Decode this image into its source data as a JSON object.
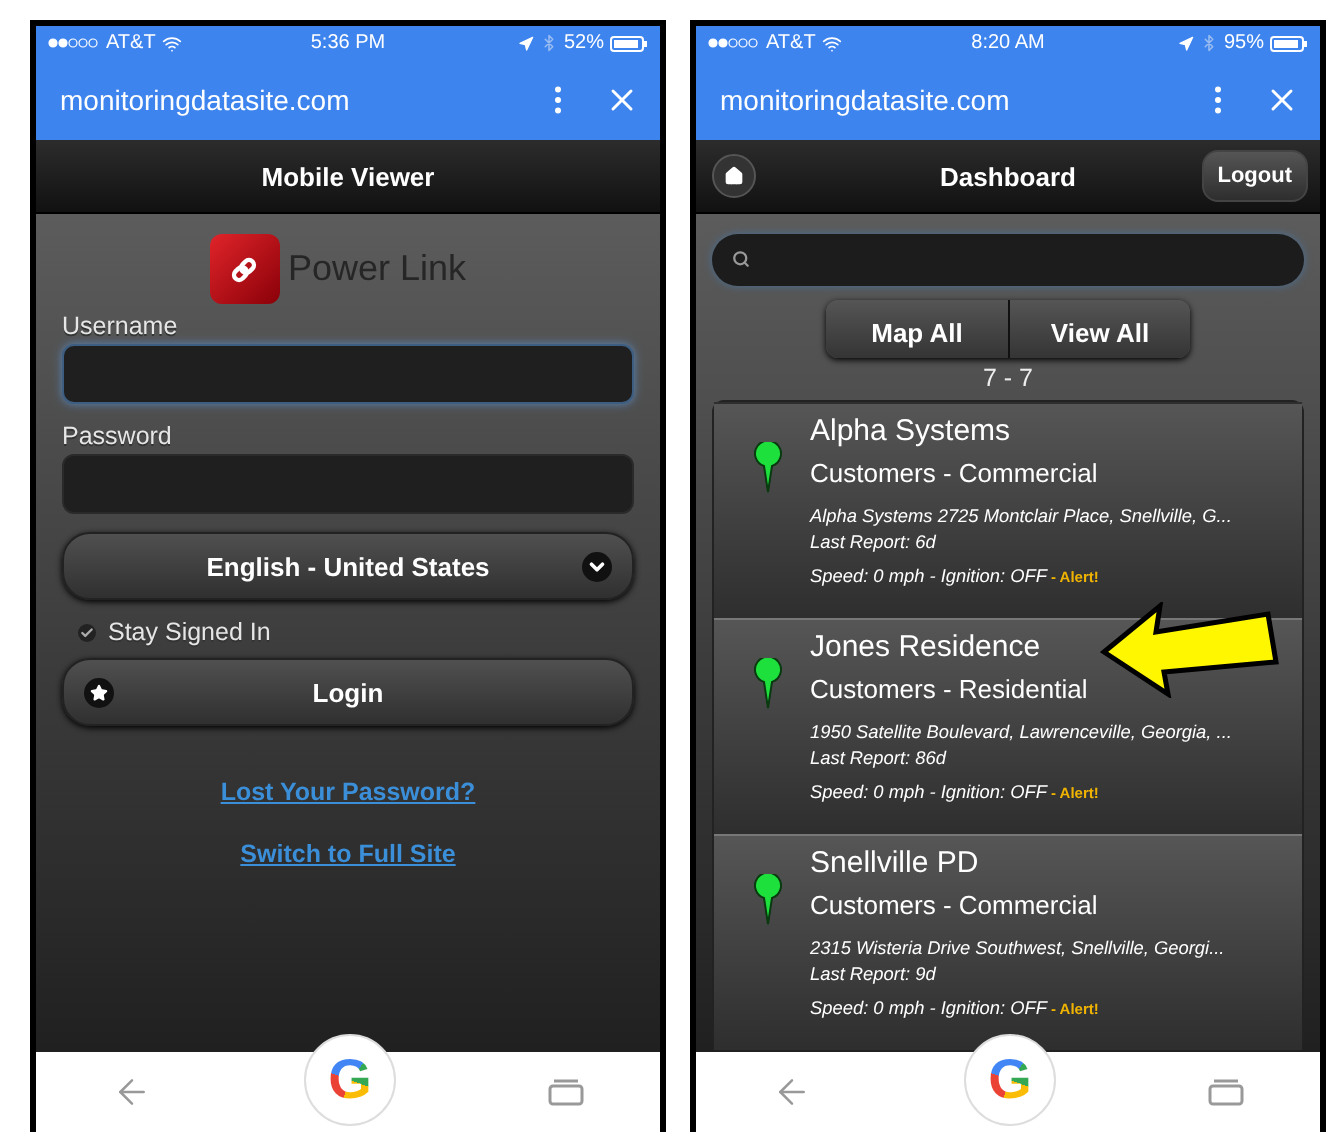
{
  "phones": [
    {
      "kind": "login",
      "status_bar": {
        "carrier": "AT&T",
        "time": "5:36 PM",
        "battery": "52%"
      },
      "browser": {
        "url": "monitoringdatasite.com"
      },
      "header": {
        "title": "Mobile Viewer"
      },
      "logo": {
        "name": "Power Link"
      },
      "fields": [
        {
          "label": "Username",
          "focused": true
        },
        {
          "label": "Password",
          "focused": false
        }
      ],
      "language": {
        "value": "English - United States"
      },
      "stay_signed_in": {
        "label": "Stay Signed In",
        "checked": true
      },
      "login_button": "Login",
      "links": [
        "Lost Your Password? ",
        "Switch to Full Site"
      ],
      "nav": {
        "logo_letter": "G"
      }
    },
    {
      "kind": "dashboard",
      "status_bar": {
        "carrier": "AT&T",
        "time": "8:20 AM",
        "battery": "95%"
      },
      "browser": {
        "url": "monitoringdatasite.com"
      },
      "header": {
        "title": "Dashboard",
        "logout": "Logout"
      },
      "buttons": [
        "Map All",
        "View All"
      ],
      "count": "7 - 7",
      "items": [
        {
          "name": "Alpha Systems",
          "category": "Customers - Commercial",
          "address": "Alpha Systems 2725 Montclair Place, Snellville, G...",
          "last_report": "Last Report: 6d",
          "speed": "Speed: 0 mph - Ignition: OFF",
          "alert": "- Alert!",
          "pointer": false
        },
        {
          "name": "Jones Residence",
          "category": "Customers - Residential",
          "address": "1950 Satellite Boulevard, Lawrenceville, Georgia, ...",
          "last_report": "Last Report: 86d",
          "speed": "Speed: 0 mph - Ignition: OFF",
          "alert": "- Alert!",
          "pointer": true
        },
        {
          "name": "Snellville PD",
          "category": "Customers - Commercial",
          "address": "2315 Wisteria Drive Southwest, Snellville, Georgi...",
          "last_report": "Last Report: 9d",
          "speed": "Speed: 0 mph - Ignition: OFF",
          "alert": "- Alert!",
          "pointer": false
        }
      ],
      "nav": {
        "logo_letter": "G"
      }
    }
  ]
}
